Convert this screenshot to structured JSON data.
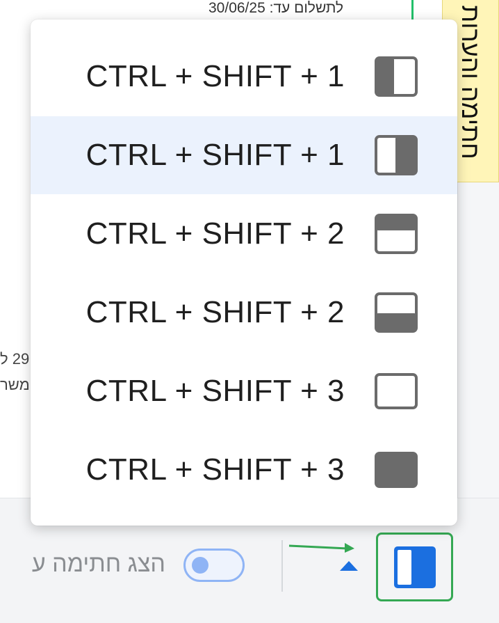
{
  "background": {
    "payment_due_text": "לתשלום עד: 30/06/25",
    "yellow_tab_text": "חתימה והערות",
    "left_fragment_1": "29 ל",
    "left_fragment_2": "משר"
  },
  "menu": {
    "items": [
      {
        "shortcut": "CTRL + SHIFT + 1",
        "icon": "layout-left-filled-icon"
      },
      {
        "shortcut": "CTRL + SHIFT + 1",
        "icon": "layout-right-filled-icon"
      },
      {
        "shortcut": "CTRL + SHIFT + 2",
        "icon": "layout-top-filled-icon"
      },
      {
        "shortcut": "CTRL + SHIFT + 2",
        "icon": "layout-bottom-filled-icon"
      },
      {
        "shortcut": "CTRL + SHIFT + 3",
        "icon": "layout-empty-icon"
      },
      {
        "shortcut": "CTRL + SHIFT + 3",
        "icon": "layout-full-icon"
      }
    ],
    "highlighted_index": 1
  },
  "bottom_bar": {
    "show_signature_label": "הצג חתימה ע",
    "toggle_state": "off",
    "layout_button_icon": "layout-right-filled-icon"
  },
  "colors": {
    "menu_highlight": "#ebf2fd",
    "icon_gray": "#6b6b6b",
    "accent_blue": "#1b6fe0",
    "green_border": "#34a853"
  }
}
